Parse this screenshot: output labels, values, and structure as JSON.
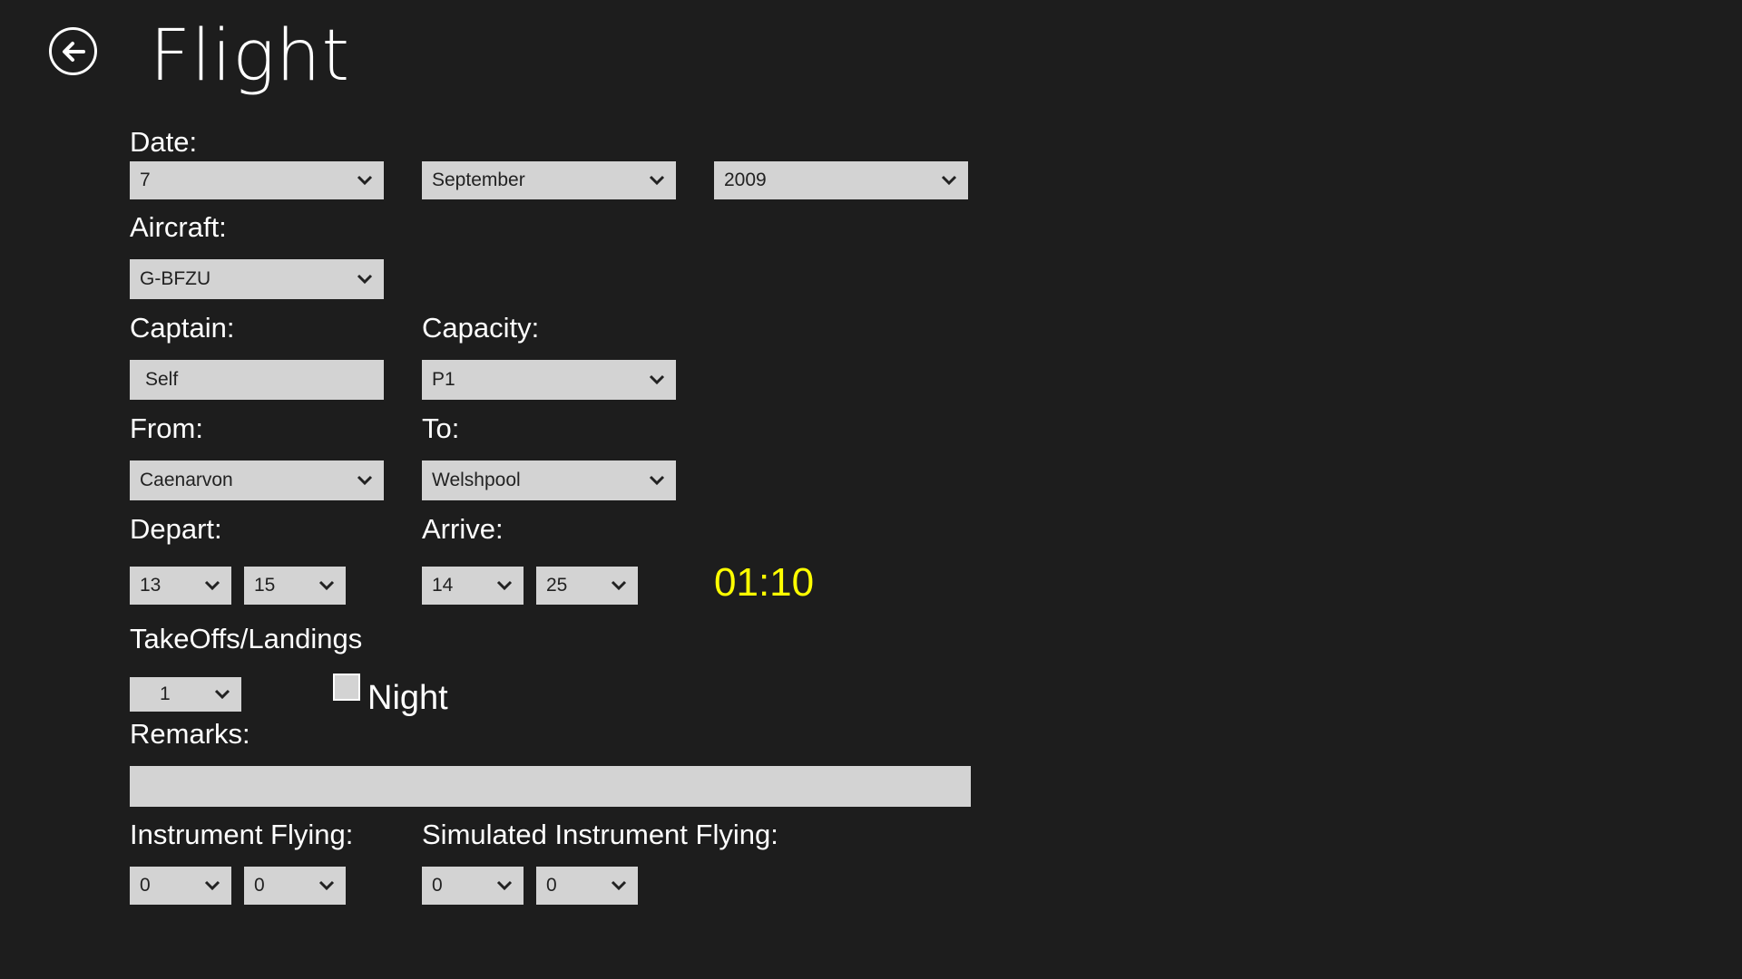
{
  "header": {
    "title": "Flight"
  },
  "form": {
    "date_label": "Date:",
    "date_day": "7",
    "date_month": "September",
    "date_year": "2009",
    "aircraft_label": "Aircraft:",
    "aircraft": "G-BFZU",
    "captain_label": "Captain:",
    "captain": "Self",
    "capacity_label": "Capacity:",
    "capacity": "P1",
    "from_label": "From:",
    "from": "Caenarvon",
    "to_label": "To:",
    "to": "Welshpool",
    "depart_label": "Depart:",
    "depart_hour": "13",
    "depart_minute": "15",
    "arrive_label": "Arrive:",
    "arrive_hour": "14",
    "arrive_minute": "25",
    "duration": "01:10",
    "takeoffs_label": "TakeOffs/Landings",
    "takeoffs": "1",
    "night_label": "Night",
    "night_checked": false,
    "remarks_label": "Remarks:",
    "remarks": "",
    "instrument_label": "Instrument Flying:",
    "instrument_hours": "0",
    "instrument_minutes": "0",
    "sim_instrument_label": "Simulated Instrument Flying:",
    "sim_instrument_hours": "0",
    "sim_instrument_minutes": "0"
  },
  "colors": {
    "background": "#1d1d1d",
    "field": "#d3d3d3",
    "duration": "#ffff00"
  }
}
